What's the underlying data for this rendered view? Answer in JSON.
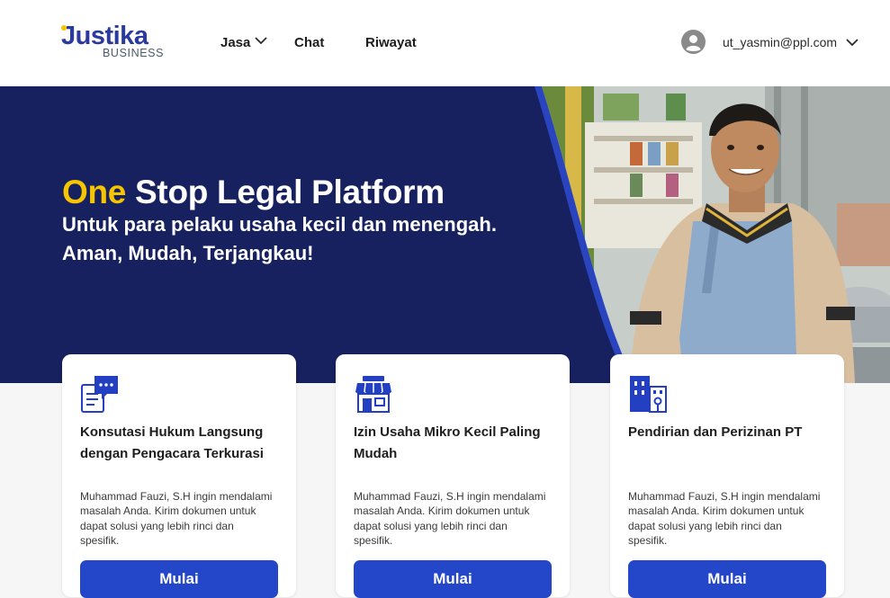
{
  "header": {
    "logo_text": "Justika",
    "logo_sub": "BUSINESS",
    "nav": {
      "jasa": "Jasa",
      "chat": "Chat",
      "riwayat": "Riwayat"
    },
    "user_email": "ut_yasmin@ppl.com"
  },
  "hero": {
    "title_accent": "One",
    "title_rest": " Stop Legal Platform",
    "subtitle_line1": "Untuk para pelaku usaha kecil dan menengah.",
    "subtitle_line2": "Aman, Mudah, Terjangkau!"
  },
  "cards": [
    {
      "icon": "chat-document-icon",
      "title": "Konsutasi Hukum Langsung dengan Pengacara Terkurasi",
      "description": "Muhammad Fauzi, S.H ingin mendalami masalah Anda. Kirim dokumen untuk dapat solusi yang lebih rinci dan spesifik.",
      "button": "Mulai"
    },
    {
      "icon": "storefront-icon",
      "title": "Izin Usaha Mikro Kecil Paling Mudah",
      "description": "Muhammad Fauzi, S.H ingin mendalami masalah Anda. Kirim dokumen untuk dapat solusi yang lebih rinci dan spesifik.",
      "button": "Mulai"
    },
    {
      "icon": "office-building-icon",
      "title": "Pendirian dan Perizinan PT",
      "description": "Muhammad Fauzi, S.H ingin mendalami masalah Anda. Kirim dokumen untuk dapat solusi yang lebih rinci dan spesifik.",
      "button": "Mulai"
    }
  ],
  "colors": {
    "brand_navy": "#17215f",
    "accent_yellow": "#f6c400",
    "button_blue": "#2347c8"
  }
}
